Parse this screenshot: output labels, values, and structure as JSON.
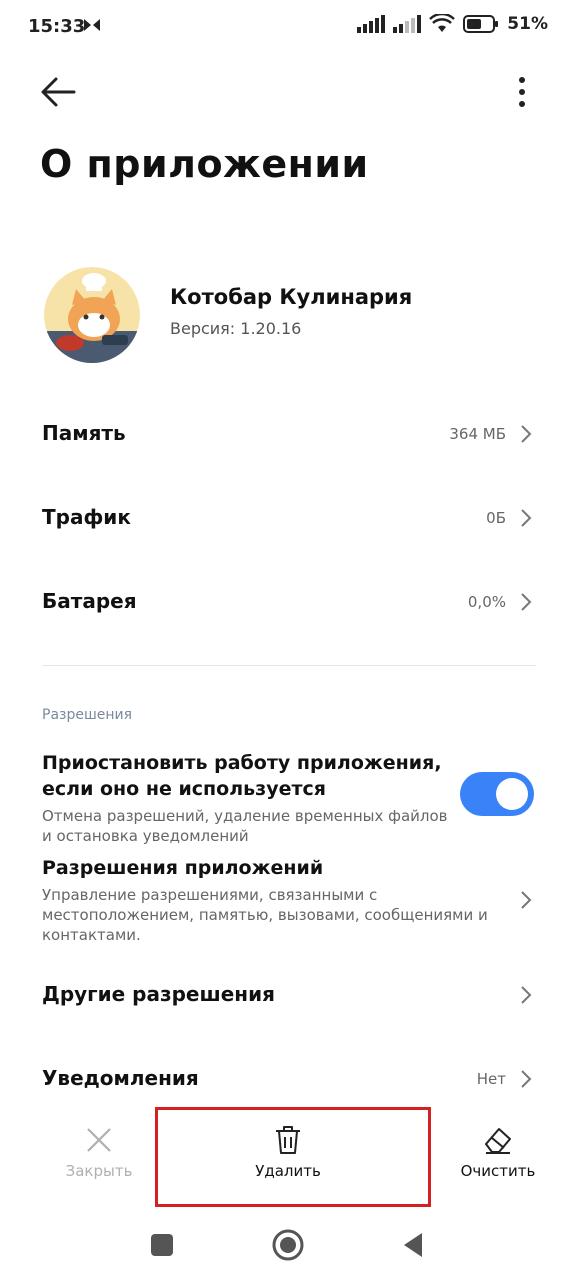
{
  "status_bar": {
    "time": "15:33",
    "battery_text": "51%"
  },
  "header": {
    "back_icon": "arrow-left-icon",
    "more_icon": "more-vertical-icon"
  },
  "page": {
    "title": "О приложении"
  },
  "app": {
    "name": "Котобар Кулинария",
    "version": "Версия: 1.20.16"
  },
  "rows": [
    {
      "label": "Память",
      "value": "364 МБ"
    },
    {
      "label": "Трафик",
      "value": "0Б"
    },
    {
      "label": "Батарея",
      "value": "0,0%"
    }
  ],
  "permissions": {
    "section_title": "Разрешения",
    "pause_app": {
      "title": "Приостановить работу приложения, если оно не используется",
      "description": "Отмена разрешений, удаление временных файлов и остановка уведомлений",
      "enabled": true
    },
    "app_permissions": {
      "title": "Разрешения приложений",
      "description": "Управление разрешениями, связанными с местоположением, памятью, вызовами, сообщениями и контактами."
    },
    "other_permissions": {
      "title": "Другие разрешения"
    },
    "notifications": {
      "title": "Уведомления",
      "value": "Нет"
    }
  },
  "actions": {
    "close_label": "Закрыть",
    "delete_label": "Удалить",
    "clear_label": "Очистить"
  },
  "colors": {
    "accent": "#3a82f7",
    "highlight": "#d42020"
  }
}
